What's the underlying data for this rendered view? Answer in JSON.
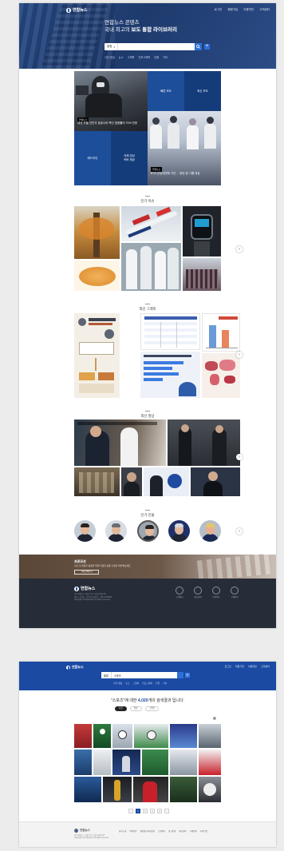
{
  "main_page": {
    "header": {
      "logo_text": "연합뉴스",
      "nav": [
        "로그인",
        "회원가입",
        "이용약관",
        "고객센터"
      ],
      "title_line1": "연합뉴스 콘텐츠",
      "title_line2_prefix": "국내 최고의 ",
      "title_line2_bold": "보도 통합 라이브러리",
      "search_scope": "통합",
      "search_placeholder": "",
      "search_button_icon": "search-icon",
      "add_button": "+",
      "quick_links": [
        "사진·영상",
        "뉴스",
        "그래픽",
        "인포그래픽",
        "인물",
        "기타"
      ]
    },
    "featured": {
      "main_tag": "연합뉴스",
      "main_caption": "내년 가을 선진국 공공나라 백신 접종률이 70% 전망",
      "cell_top_left": "빠른 보도",
      "cell_top_right": "최신 보도",
      "cell_mid_left": "헤드라인",
      "cell_mid_right": "국제 영상\n커버 제공",
      "bts_tag": "연합뉴스",
      "bts_caption": "BTS 군입대면제 기간 ... 방탄 등 그룹 대상"
    },
    "sections": {
      "hot_issue": "인기 이슈",
      "graphics": "최신 그래픽",
      "video": "최신 영상",
      "people": "인기 인물"
    },
    "arrow_icon": "arrow-right-icon",
    "people_count": 5,
    "promo": {
      "title": "프로모션",
      "description": "사진 및 영상을 활용한 특별 다양한 상품 구성을 확인해보세요",
      "button": "구매 문의하기"
    },
    "footer": {
      "logo_text": "연합뉴스",
      "info_lines": [
        "(주) 연합뉴스 서울 종로구 율곡로2길 25",
        "대표 : 성기홍 · 사업자등록번호 : 101-81-56263",
        "Copyright Yonhapnews. All rights reserved."
      ],
      "icons": [
        {
          "name": "customer-center-icon",
          "label": "고객센터"
        },
        {
          "name": "mail-icon",
          "label": "제휴문의"
        },
        {
          "name": "document-icon",
          "label": "이용약관"
        },
        {
          "name": "phone-icon",
          "label": "구매안내"
        }
      ]
    }
  },
  "search_page": {
    "header": {
      "logo_text": "연합뉴스",
      "nav": [
        "로그인",
        "회원가입",
        "이용약관",
        "고객센터"
      ],
      "search_scope": "통합",
      "query": "스포츠",
      "quick_links": [
        "사진·영상",
        "뉴스",
        "그래픽",
        "인포그래픽",
        "인물",
        "기타"
      ]
    },
    "result_prefix": "\"스포츠\"에 대한 ",
    "result_count": "4,020",
    "result_suffix": "개의 검색결과 입니다.",
    "tabs": [
      "사진",
      "영상",
      "그래픽"
    ],
    "active_tab": "사진",
    "pager": [
      "<",
      "1",
      "2",
      "3",
      "4",
      ">"
    ],
    "active_page": "1",
    "footer_links": [
      "회사소개",
      "이용약관",
      "개인정보처리방침",
      "고객센터",
      "광고안내",
      "제휴문의",
      "구매문의",
      "사이트맵"
    ],
    "footer_info": [
      "(주) 연합뉴스 서울 종로구 율곡로2길 25",
      "Copyright Yonhapnews. All rights reserved."
    ]
  },
  "colors": {
    "brand_blue": "#1b4aa3",
    "accent_blue": "#2d6fd6",
    "footer_dark": "#272d38"
  }
}
